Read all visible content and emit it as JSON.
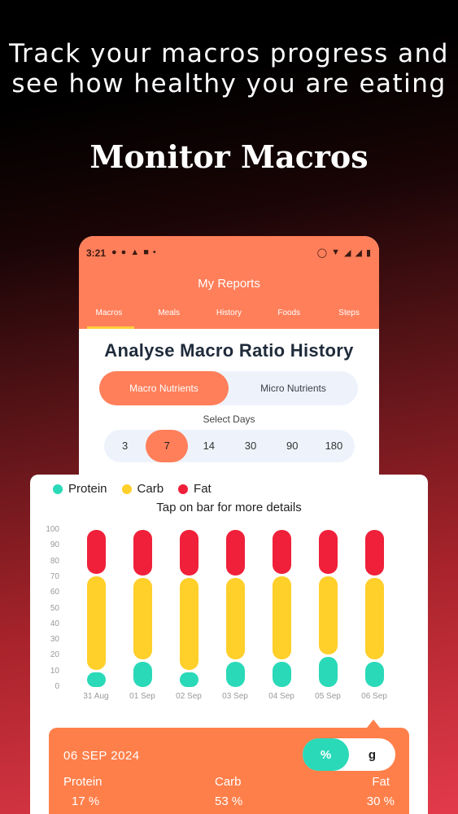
{
  "headline_line1": "Track your macros progress and",
  "headline_line2": "see how healthy you are eating",
  "hero_title": "Monitor Macros",
  "status_bar": {
    "time": "3:21"
  },
  "app": {
    "title": "My Reports",
    "tabs": [
      "Macros",
      "Meals",
      "History",
      "Foods",
      "Steps"
    ],
    "active_tab": "Macros",
    "heading": "Analyse Macro Ratio History",
    "segments": [
      "Macro Nutrients",
      "Micro Nutrients"
    ],
    "active_segment": "Macro Nutrients",
    "select_days_label": "Select Days",
    "day_options": [
      "3",
      "7",
      "14",
      "30",
      "90",
      "180"
    ],
    "active_day": "7"
  },
  "legend": [
    "Protein",
    "Carb",
    "Fat"
  ],
  "hint": "Tap on bar for more details",
  "colors": {
    "protein": "#2ad9b8",
    "carb": "#ffcf2a",
    "fat": "#f0203a",
    "accent": "#ff7f5a"
  },
  "chart_data": {
    "type": "bar",
    "stacked": true,
    "categories": [
      "31 Aug",
      "01 Sep",
      "02 Sep",
      "03 Sep",
      "04 Sep",
      "05 Sep",
      "06 Sep"
    ],
    "series": [
      {
        "name": "Protein",
        "values": [
          10,
          17,
          10,
          17,
          17,
          20,
          17
        ]
      },
      {
        "name": "Carb",
        "values": [
          61,
          53,
          60,
          53,
          54,
          51,
          53
        ]
      },
      {
        "name": "Fat",
        "values": [
          29,
          30,
          30,
          30,
          29,
          29,
          30
        ]
      }
    ],
    "yticks": [
      "0",
      "10",
      "20",
      "30",
      "40",
      "50",
      "60",
      "70",
      "80",
      "90",
      "100"
    ],
    "ylim": [
      0,
      100
    ],
    "grid": false
  },
  "detail": {
    "date": "06 SEP 2024",
    "units": [
      "%",
      "g"
    ],
    "active_unit": "%",
    "protein_label": "Protein",
    "protein_value": "17 %",
    "carb_label": "Carb",
    "carb_value": "53 %",
    "fat_label": "Fat",
    "fat_value": "30 %"
  }
}
